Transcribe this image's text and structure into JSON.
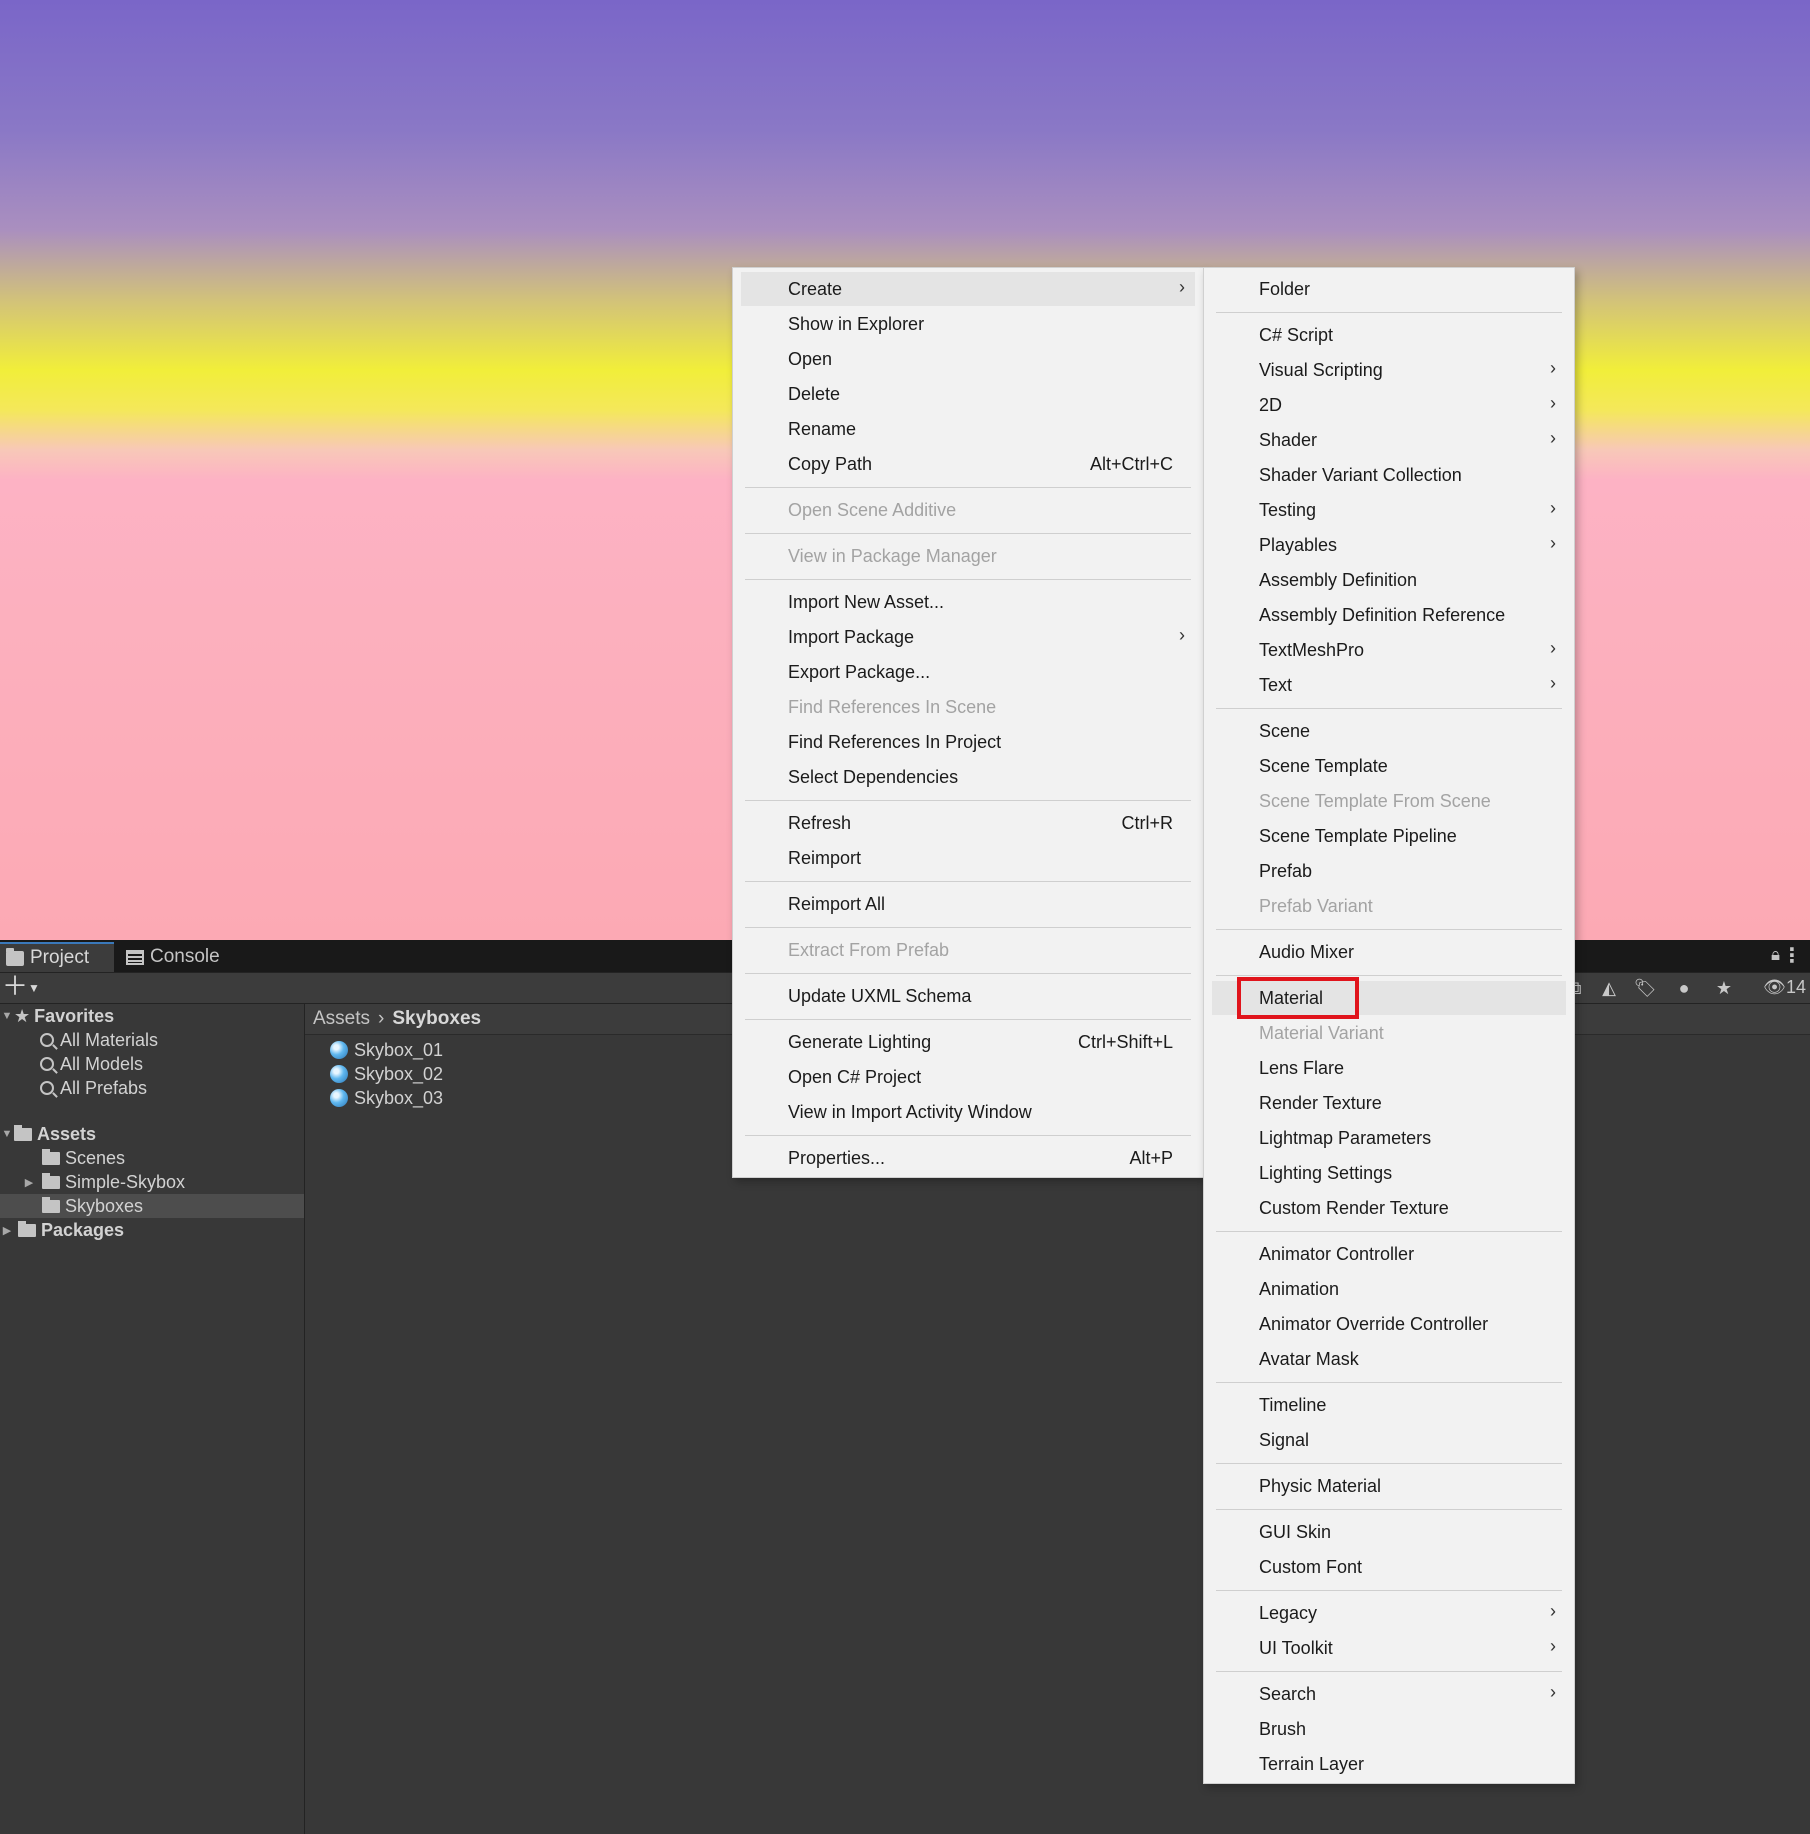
{
  "project_window": {
    "tabs": [
      {
        "label": "Project",
        "icon": "folder-icon"
      },
      {
        "label": "Console",
        "icon": "console-icon"
      }
    ],
    "hidden_count": "14",
    "tree": {
      "favorites": {
        "label": "Favorites",
        "items": [
          "All Materials",
          "All Models",
          "All Prefabs"
        ]
      },
      "assets": {
        "label": "Assets",
        "children": [
          "Scenes",
          "Simple-Skybox",
          "Skyboxes"
        ]
      },
      "packages": "Packages"
    },
    "breadcrumb": [
      "Assets",
      "Skyboxes"
    ],
    "assets": [
      "Skybox_01",
      "Skybox_02",
      "Skybox_03"
    ]
  },
  "context_menu": {
    "items": [
      {
        "label": "Create",
        "submenu": true,
        "highlighted": true
      },
      {
        "label": "Show in Explorer"
      },
      {
        "label": "Open"
      },
      {
        "label": "Delete"
      },
      {
        "label": "Rename"
      },
      {
        "label": "Copy Path",
        "shortcut": "Alt+Ctrl+C"
      },
      {
        "label": "Open Scene Additive",
        "disabled": true
      },
      {
        "label": "View in Package Manager",
        "disabled": true
      },
      {
        "label": "Import New Asset..."
      },
      {
        "label": "Import Package",
        "submenu": true
      },
      {
        "label": "Export Package..."
      },
      {
        "label": "Find References In Scene",
        "disabled": true
      },
      {
        "label": "Find References In Project"
      },
      {
        "label": "Select Dependencies"
      },
      {
        "label": "Refresh",
        "shortcut": "Ctrl+R"
      },
      {
        "label": "Reimport"
      },
      {
        "label": "Reimport All"
      },
      {
        "label": "Extract From Prefab",
        "disabled": true
      },
      {
        "label": "Update UXML Schema"
      },
      {
        "label": "Generate Lighting",
        "shortcut": "Ctrl+Shift+L"
      },
      {
        "label": "Open C# Project"
      },
      {
        "label": "View in Import Activity Window"
      },
      {
        "label": "Properties...",
        "shortcut": "Alt+P"
      }
    ]
  },
  "create_submenu": {
    "items": [
      {
        "label": "Folder"
      },
      {
        "label": "C# Script"
      },
      {
        "label": "Visual Scripting",
        "submenu": true
      },
      {
        "label": "2D",
        "submenu": true
      },
      {
        "label": "Shader",
        "submenu": true
      },
      {
        "label": "Shader Variant Collection"
      },
      {
        "label": "Testing",
        "submenu": true
      },
      {
        "label": "Playables",
        "submenu": true
      },
      {
        "label": "Assembly Definition"
      },
      {
        "label": "Assembly Definition Reference"
      },
      {
        "label": "TextMeshPro",
        "submenu": true
      },
      {
        "label": "Text",
        "submenu": true
      },
      {
        "label": "Scene"
      },
      {
        "label": "Scene Template"
      },
      {
        "label": "Scene Template From Scene",
        "disabled": true
      },
      {
        "label": "Scene Template Pipeline"
      },
      {
        "label": "Prefab"
      },
      {
        "label": "Prefab Variant",
        "disabled": true
      },
      {
        "label": "Audio Mixer"
      },
      {
        "label": "Material",
        "highlighted": true,
        "annotated": true
      },
      {
        "label": "Material Variant",
        "disabled": true
      },
      {
        "label": "Lens Flare"
      },
      {
        "label": "Render Texture"
      },
      {
        "label": "Lightmap Parameters"
      },
      {
        "label": "Lighting Settings"
      },
      {
        "label": "Custom Render Texture"
      },
      {
        "label": "Animator Controller"
      },
      {
        "label": "Animation"
      },
      {
        "label": "Animator Override Controller"
      },
      {
        "label": "Avatar Mask"
      },
      {
        "label": "Timeline"
      },
      {
        "label": "Signal"
      },
      {
        "label": "Physic Material"
      },
      {
        "label": "GUI Skin"
      },
      {
        "label": "Custom Font"
      },
      {
        "label": "Legacy",
        "submenu": true
      },
      {
        "label": "UI Toolkit",
        "submenu": true
      },
      {
        "label": "Search",
        "submenu": true
      },
      {
        "label": "Brush"
      },
      {
        "label": "Terrain Layer"
      }
    ]
  },
  "colors": {
    "annotation_box": "#e0141c",
    "menu_background": "#f2f2f2",
    "panel_background": "#383838"
  }
}
